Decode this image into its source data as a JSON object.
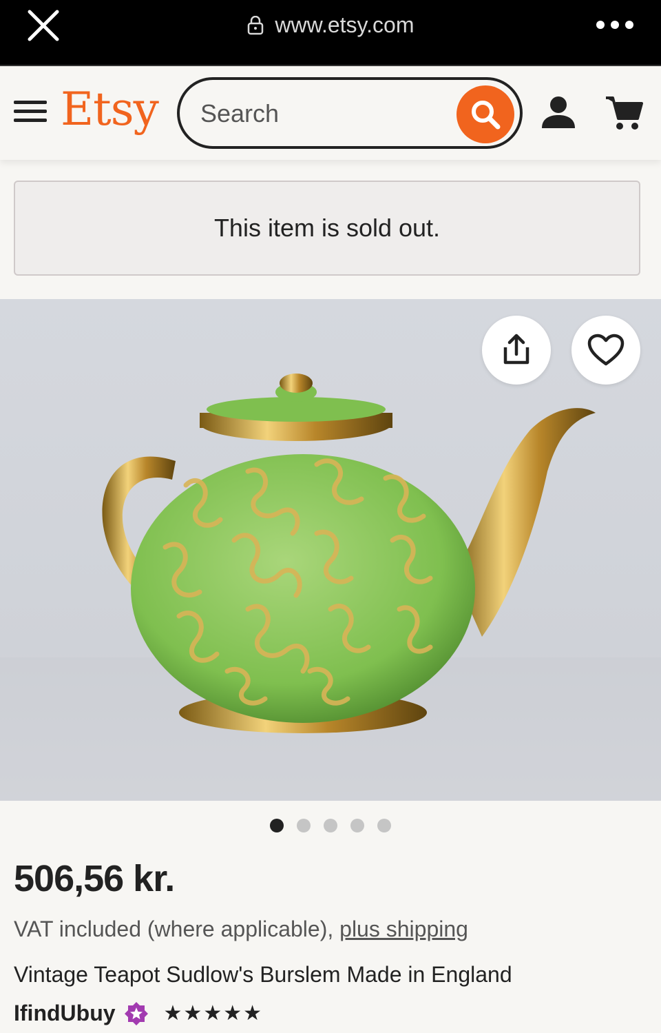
{
  "browser": {
    "url": "www.etsy.com"
  },
  "header": {
    "logo": "Etsy",
    "search_placeholder": "Search",
    "brand_color": "#f1641e"
  },
  "notice": {
    "sold_out_text": "This item is sold out."
  },
  "carousel": {
    "total_images": 5,
    "active_index": 0
  },
  "product": {
    "price": "506,56 kr.",
    "vat_text": "VAT included (where applicable), ",
    "shipping_link": "plus shipping",
    "title": "Vintage Teapot Sudlow's Burslem Made in England",
    "shop_name": "IfindUbuy",
    "rating_stars": "★★★★★",
    "rating_value": 5
  }
}
